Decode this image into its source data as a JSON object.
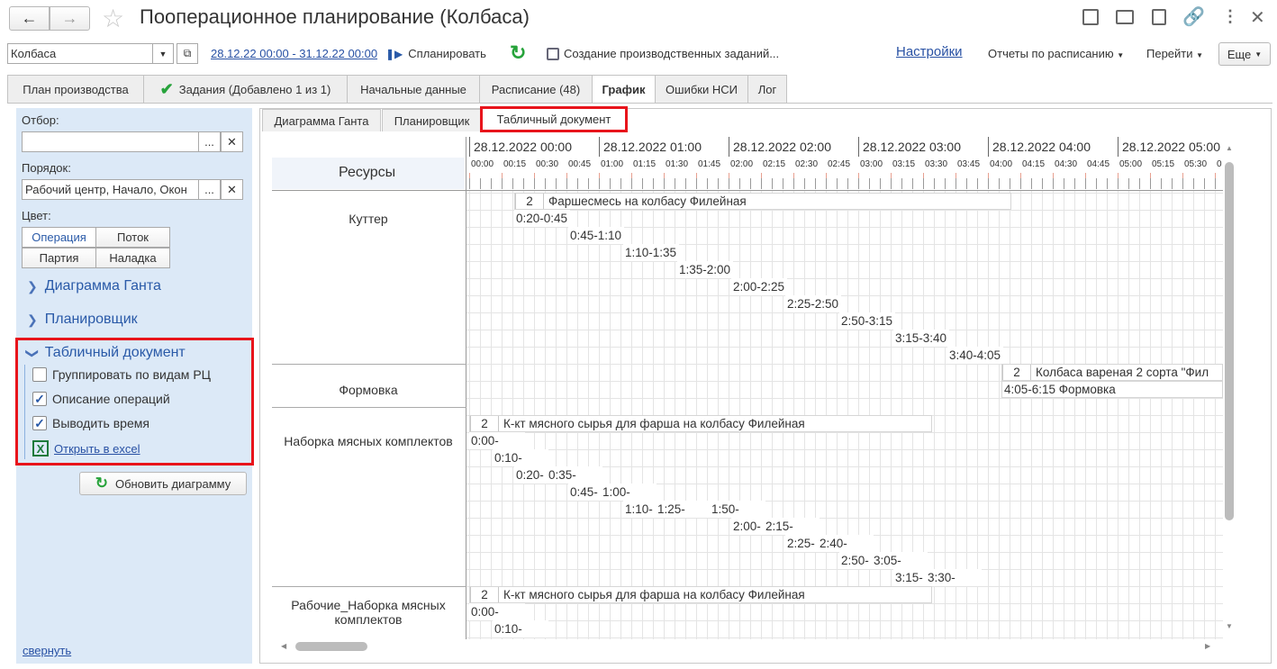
{
  "window": {
    "title": "Пооперационное планирование (Колбаса)"
  },
  "toolbar": {
    "product_value": "Колбаса",
    "period_link": "28.12.22 00:00 - 31.12.22 00:00",
    "plan_label": "Спланировать",
    "create_tasks_label": "Создание производственных заданий...",
    "settings_link": "Настройки",
    "reports_label": "Отчеты по расписанию",
    "goto_label": "Перейти",
    "more_label": "Еще"
  },
  "tabs": [
    "План производства",
    "Задания (Добавлено 1 из 1)",
    "Начальные данные",
    "Расписание (48)",
    "График",
    "Ошибки НСИ",
    "Лог"
  ],
  "sidebar": {
    "filter_label": "Отбор:",
    "filter_value": "",
    "order_label": "Порядок:",
    "order_value": "Рабочий центр, Начало, Окон",
    "color_label": "Цвет:",
    "color_options": [
      "Операция",
      "Поток",
      "Партия",
      "Наладка"
    ],
    "groups": [
      "Диаграмма Ганта",
      "Планировщик",
      "Табличный документ"
    ],
    "checkboxes": [
      {
        "label": "Группировать по видам РЦ",
        "checked": false
      },
      {
        "label": "Описание операций",
        "checked": true
      },
      {
        "label": "Выводить время",
        "checked": true
      }
    ],
    "excel_link": "Открыть в excel",
    "refresh_label": "Обновить диаграмму",
    "collapse_link": "свернуть",
    "ellipsis": "...",
    "clear": "✕"
  },
  "subtabs": [
    "Диаграмма Ганта",
    "Планировщик",
    "Табличный документ"
  ],
  "gantt": {
    "resources_header": "Ресурсы",
    "hours": [
      "28.12.2022 00:00",
      "28.12.2022 01:00",
      "28.12.2022 02:00",
      "28.12.2022 03:00",
      "28.12.2022 04:00",
      "28.12.2022 05:00"
    ],
    "ticks": [
      "00:00",
      "00:15",
      "00:30",
      "00:45",
      "01:00",
      "01:15",
      "01:30",
      "01:45",
      "02:00",
      "02:15",
      "02:30",
      "02:45",
      "03:00",
      "03:15",
      "03:30",
      "03:45",
      "04:00",
      "04:15",
      "04:30",
      "04:45",
      "05:00",
      "05:15",
      "05:30",
      "0"
    ],
    "resources": [
      "Куттер",
      "Формовка",
      "Наборка мясных комплектов",
      "Рабочие_Наборка мясных комплектов"
    ],
    "bars": [
      {
        "num": "2",
        "text": "Фаршесмесь на колбасу Филейная"
      },
      {
        "text": "0:20-0:45 ("
      },
      {
        "text": "0:45-1:10 ("
      },
      {
        "text": "1:10-1:35 ("
      },
      {
        "text": "1:35-2:00 ("
      },
      {
        "text": "2:00-2:25 ("
      },
      {
        "text": "2:25-2:50 ("
      },
      {
        "text": "2:50-3:15 ("
      },
      {
        "text": "3:15-3:40 ("
      },
      {
        "text": "3:40-4:05 ("
      },
      {
        "num": "2",
        "text": "Колбаса вареная 2 сорта \"Фил"
      },
      {
        "text": "4:05-6:15 Формовка"
      },
      {
        "num": "2",
        "text": "К-кт мясного сырья для фарша на колбасу Филейная"
      },
      {
        "text": "0:00-"
      },
      {
        "text": "0:10-"
      },
      {
        "text": "0:20-"
      },
      {
        "text": "0:35-"
      },
      {
        "text": "0:45-"
      },
      {
        "text": "1:00-"
      },
      {
        "text": "1:10-"
      },
      {
        "text": "1:25-"
      },
      {
        "text": "1:50-"
      },
      {
        "text": "2:00-"
      },
      {
        "text": "2:15-"
      },
      {
        "text": "2:25-"
      },
      {
        "text": "2:40-"
      },
      {
        "text": "2:50-"
      },
      {
        "text": "3:05-"
      },
      {
        "text": "3:15-"
      },
      {
        "text": "3:30-"
      },
      {
        "num": "2",
        "text": "К-кт мясного сырья для фарша на колбасу Филейная"
      },
      {
        "text": "0:00-"
      },
      {
        "text": "0:10-"
      }
    ]
  }
}
